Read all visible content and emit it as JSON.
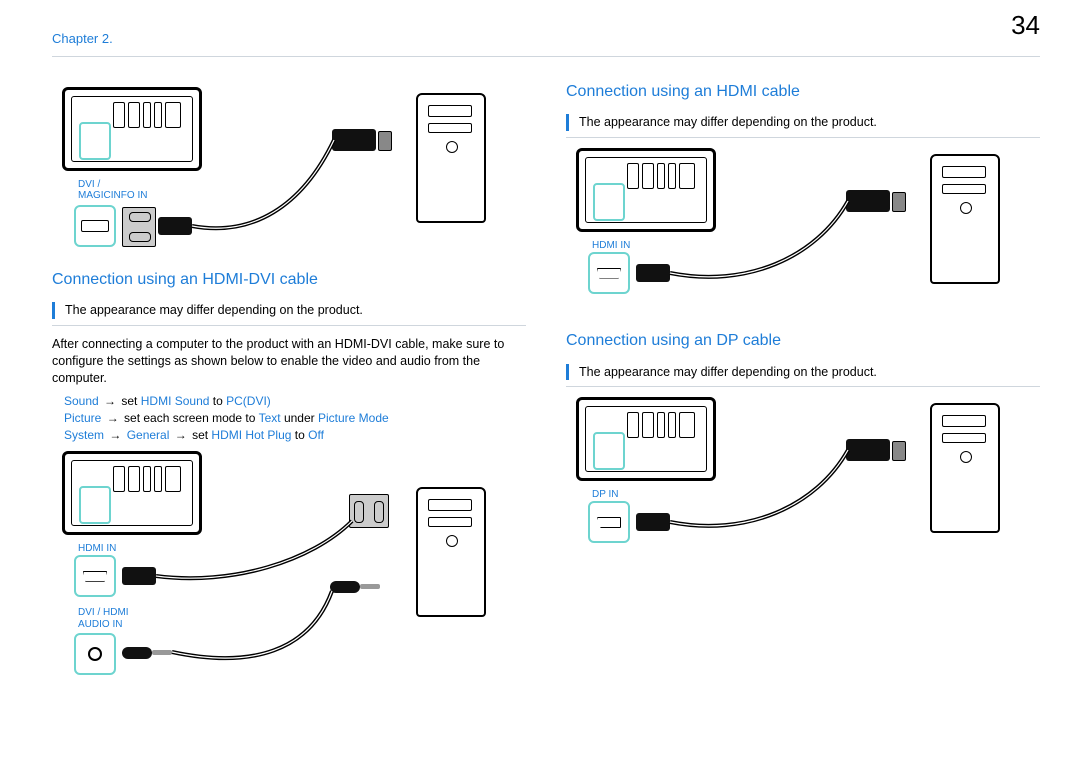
{
  "page_number": "34",
  "chapter_label": "Chapter 2.",
  "left": {
    "diagram1_port_label": "DVI /\nMAGICINFO IN",
    "section1_title": "Connection using an HDMI-DVI cable",
    "note1": "The appearance may differ depending on the product.",
    "body1": "After connecting a computer to the product with an HDMI-DVI cable, make sure to configure the settings as shown below to enable the video and audio from the computer.",
    "menu1_sound_a": "Sound",
    "menu1_set": "set",
    "menu1_sound_b": "HDMI Sound",
    "menu1_to": "to",
    "menu1_sound_c": "PC(DVI)",
    "menu2_pic_a": "Picture",
    "menu2_txt": "set each screen mode to",
    "menu2_pic_b": "Text",
    "menu2_under": "under",
    "menu2_pic_c": "Picture Mode",
    "menu3_sys_a": "System",
    "menu3_sys_b": "General",
    "menu3_set": "set",
    "menu3_sys_c": "HDMI Hot Plug",
    "menu3_to": "to",
    "menu3_sys_d": "Off",
    "diagram2_port1_label": "HDMI IN",
    "diagram2_port2_label": "DVI / HDMI\nAUDIO IN"
  },
  "right": {
    "section1_title": "Connection using an HDMI cable",
    "note1": "The appearance may differ depending on the product.",
    "diagram1_port_label": "HDMI IN",
    "section2_title": "Connection using an DP cable",
    "note2": "The appearance may differ depending on the product.",
    "diagram2_port_label": "DP IN"
  }
}
